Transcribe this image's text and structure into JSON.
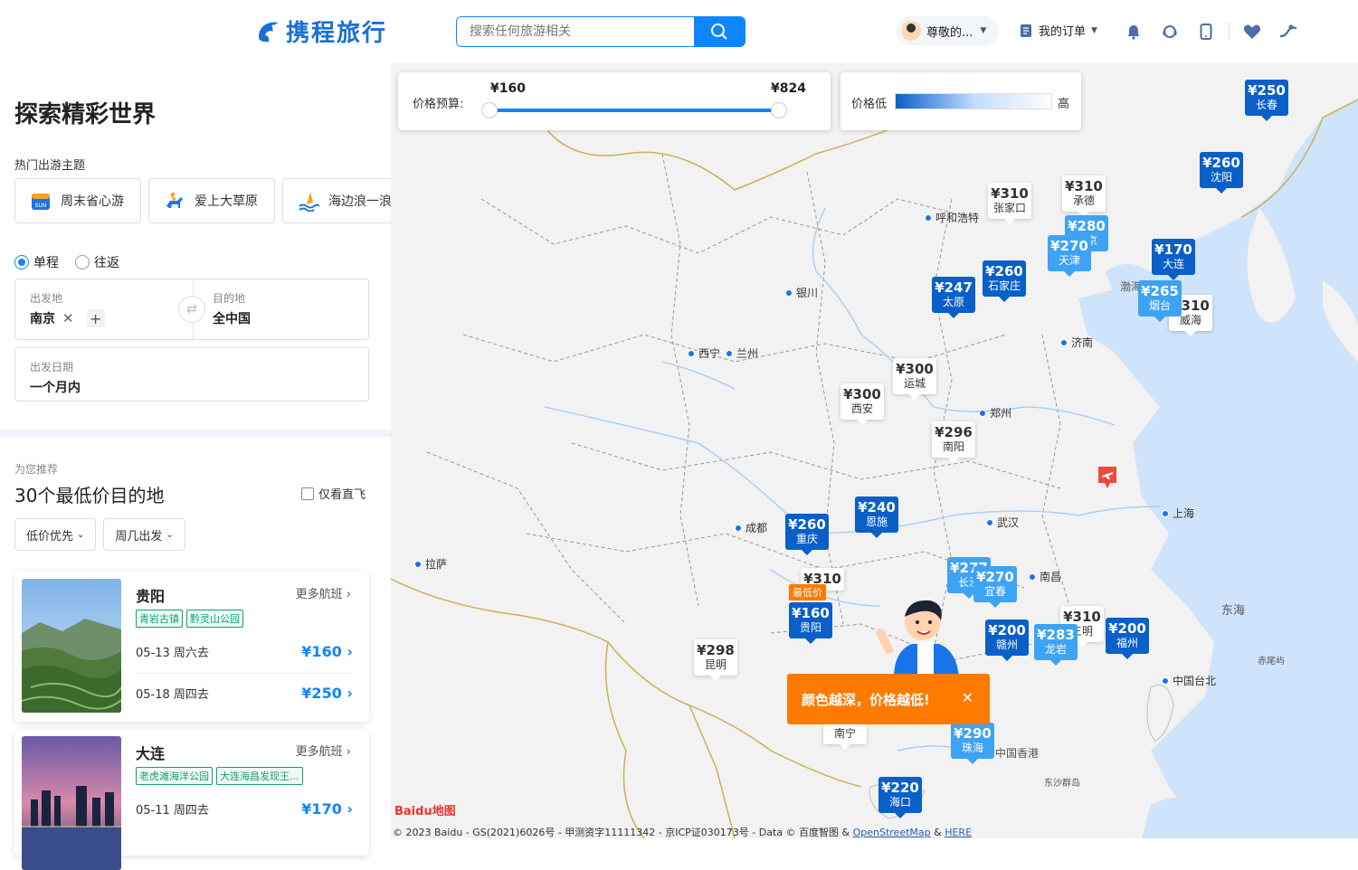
{
  "header": {
    "logo_text": "携程旅行",
    "search_placeholder": "搜索任何旅游相关",
    "user_label": "尊敬的...",
    "orders_label": "我的订单"
  },
  "left": {
    "title": "探索精彩世界",
    "theme_label": "热门出游主题",
    "themes": [
      {
        "label": "周末省心游",
        "icon": "sun-calendar-icon"
      },
      {
        "label": "爱上大草原",
        "icon": "horse-rider-icon"
      },
      {
        "label": "海边浪一浪",
        "icon": "surfing-icon"
      }
    ],
    "trip_types": [
      "单程",
      "往返"
    ],
    "from_label": "出发地",
    "from_value": "南京",
    "to_label": "目的地",
    "to_value": "全中国",
    "date_label": "出发日期",
    "date_value": "一个月内",
    "rec_label": "为您推荐",
    "rec_title": "30个最低价目的地",
    "direct_label": "仅看直飞",
    "filters": [
      "低价优先",
      "周几出发"
    ],
    "cards": [
      {
        "city": "贵阳",
        "more": "更多航班",
        "tags": [
          "青岩古镇",
          "黔灵山公园"
        ],
        "flights": [
          {
            "date": "05-13 周六去",
            "price": "¥160"
          },
          {
            "date": "05-18 周四去",
            "price": "¥250"
          }
        ]
      },
      {
        "city": "大连",
        "more": "更多航班",
        "tags": [
          "老虎滩海洋公园",
          "大连海昌发现王..."
        ],
        "flights": [
          {
            "date": "05-11 周四去",
            "price": "¥170"
          }
        ]
      }
    ]
  },
  "map": {
    "price_label": "价格预算:",
    "price_min": "¥160",
    "price_max": "¥824",
    "legend_low": "价格低",
    "legend_high": "高",
    "lowest_badge": "最低价",
    "tip": "颜色越深，价格越低!",
    "copyright": "© 2023 Baidu - GS(2021)6026号 - 甲测资字11111342 - 京ICP证030173号 - Data © 百度智图 &",
    "osm": "OpenStreetMap",
    "amp": "&",
    "here": "HERE",
    "baidu": "Baidu地图",
    "pins": [
      {
        "price": "¥250",
        "city": "长春",
        "shade": "d"
      },
      {
        "price": "¥260",
        "city": "沈阳",
        "shade": "d"
      },
      {
        "price": "¥310",
        "city": "张家口",
        "shade": "w"
      },
      {
        "price": "¥310",
        "city": "承德",
        "shade": "w"
      },
      {
        "price": "¥280",
        "city": "北京",
        "shade": "l"
      },
      {
        "price": "¥270",
        "city": "天津",
        "shade": "l"
      },
      {
        "price": "¥170",
        "city": "大连",
        "shade": "d"
      },
      {
        "price": "¥265",
        "city": "烟台",
        "shade": "l"
      },
      {
        "price": "¥310",
        "city": "威海",
        "shade": "w"
      },
      {
        "price": "¥247",
        "city": "太原",
        "shade": "d"
      },
      {
        "price": "¥260",
        "city": "石家庄",
        "shade": "d"
      },
      {
        "price": "¥300",
        "city": "运城",
        "shade": "w"
      },
      {
        "price": "¥300",
        "city": "西安",
        "shade": "w"
      },
      {
        "price": "¥296",
        "city": "南阳",
        "shade": "w"
      },
      {
        "price": "¥240",
        "city": "恩施",
        "shade": "d"
      },
      {
        "price": "¥260",
        "city": "重庆",
        "shade": "d"
      },
      {
        "price": "¥310",
        "city": "",
        "shade": "w"
      },
      {
        "price": "¥160",
        "city": "贵阳",
        "shade": "d"
      },
      {
        "price": "¥277",
        "city": "长沙",
        "shade": "l"
      },
      {
        "price": "¥270",
        "city": "宜春",
        "shade": "l"
      },
      {
        "price": "¥298",
        "city": "昆明",
        "shade": "w"
      },
      {
        "price": "¥200",
        "city": "赣州",
        "shade": "d"
      },
      {
        "price": "¥283",
        "city": "龙岩",
        "shade": "l"
      },
      {
        "price": "¥310",
        "city": "三明",
        "shade": "w"
      },
      {
        "price": "¥200",
        "city": "福州",
        "shade": "d"
      },
      {
        "price": "¥290",
        "city": "珠海",
        "shade": "l"
      },
      {
        "price": "¥220",
        "city": "海口",
        "shade": "d"
      },
      {
        "price": "",
        "city": "南宁",
        "shade": "w"
      }
    ],
    "cities": [
      "呼和浩特",
      "银川",
      "西宁",
      "兰州",
      "济南",
      "郑州",
      "成都",
      "武汉",
      "上海",
      "拉萨",
      "南昌",
      "中国台北"
    ],
    "labels": [
      "渤海",
      "东海",
      "赤尾屿",
      "东沙群岛",
      "中国香港"
    ]
  }
}
